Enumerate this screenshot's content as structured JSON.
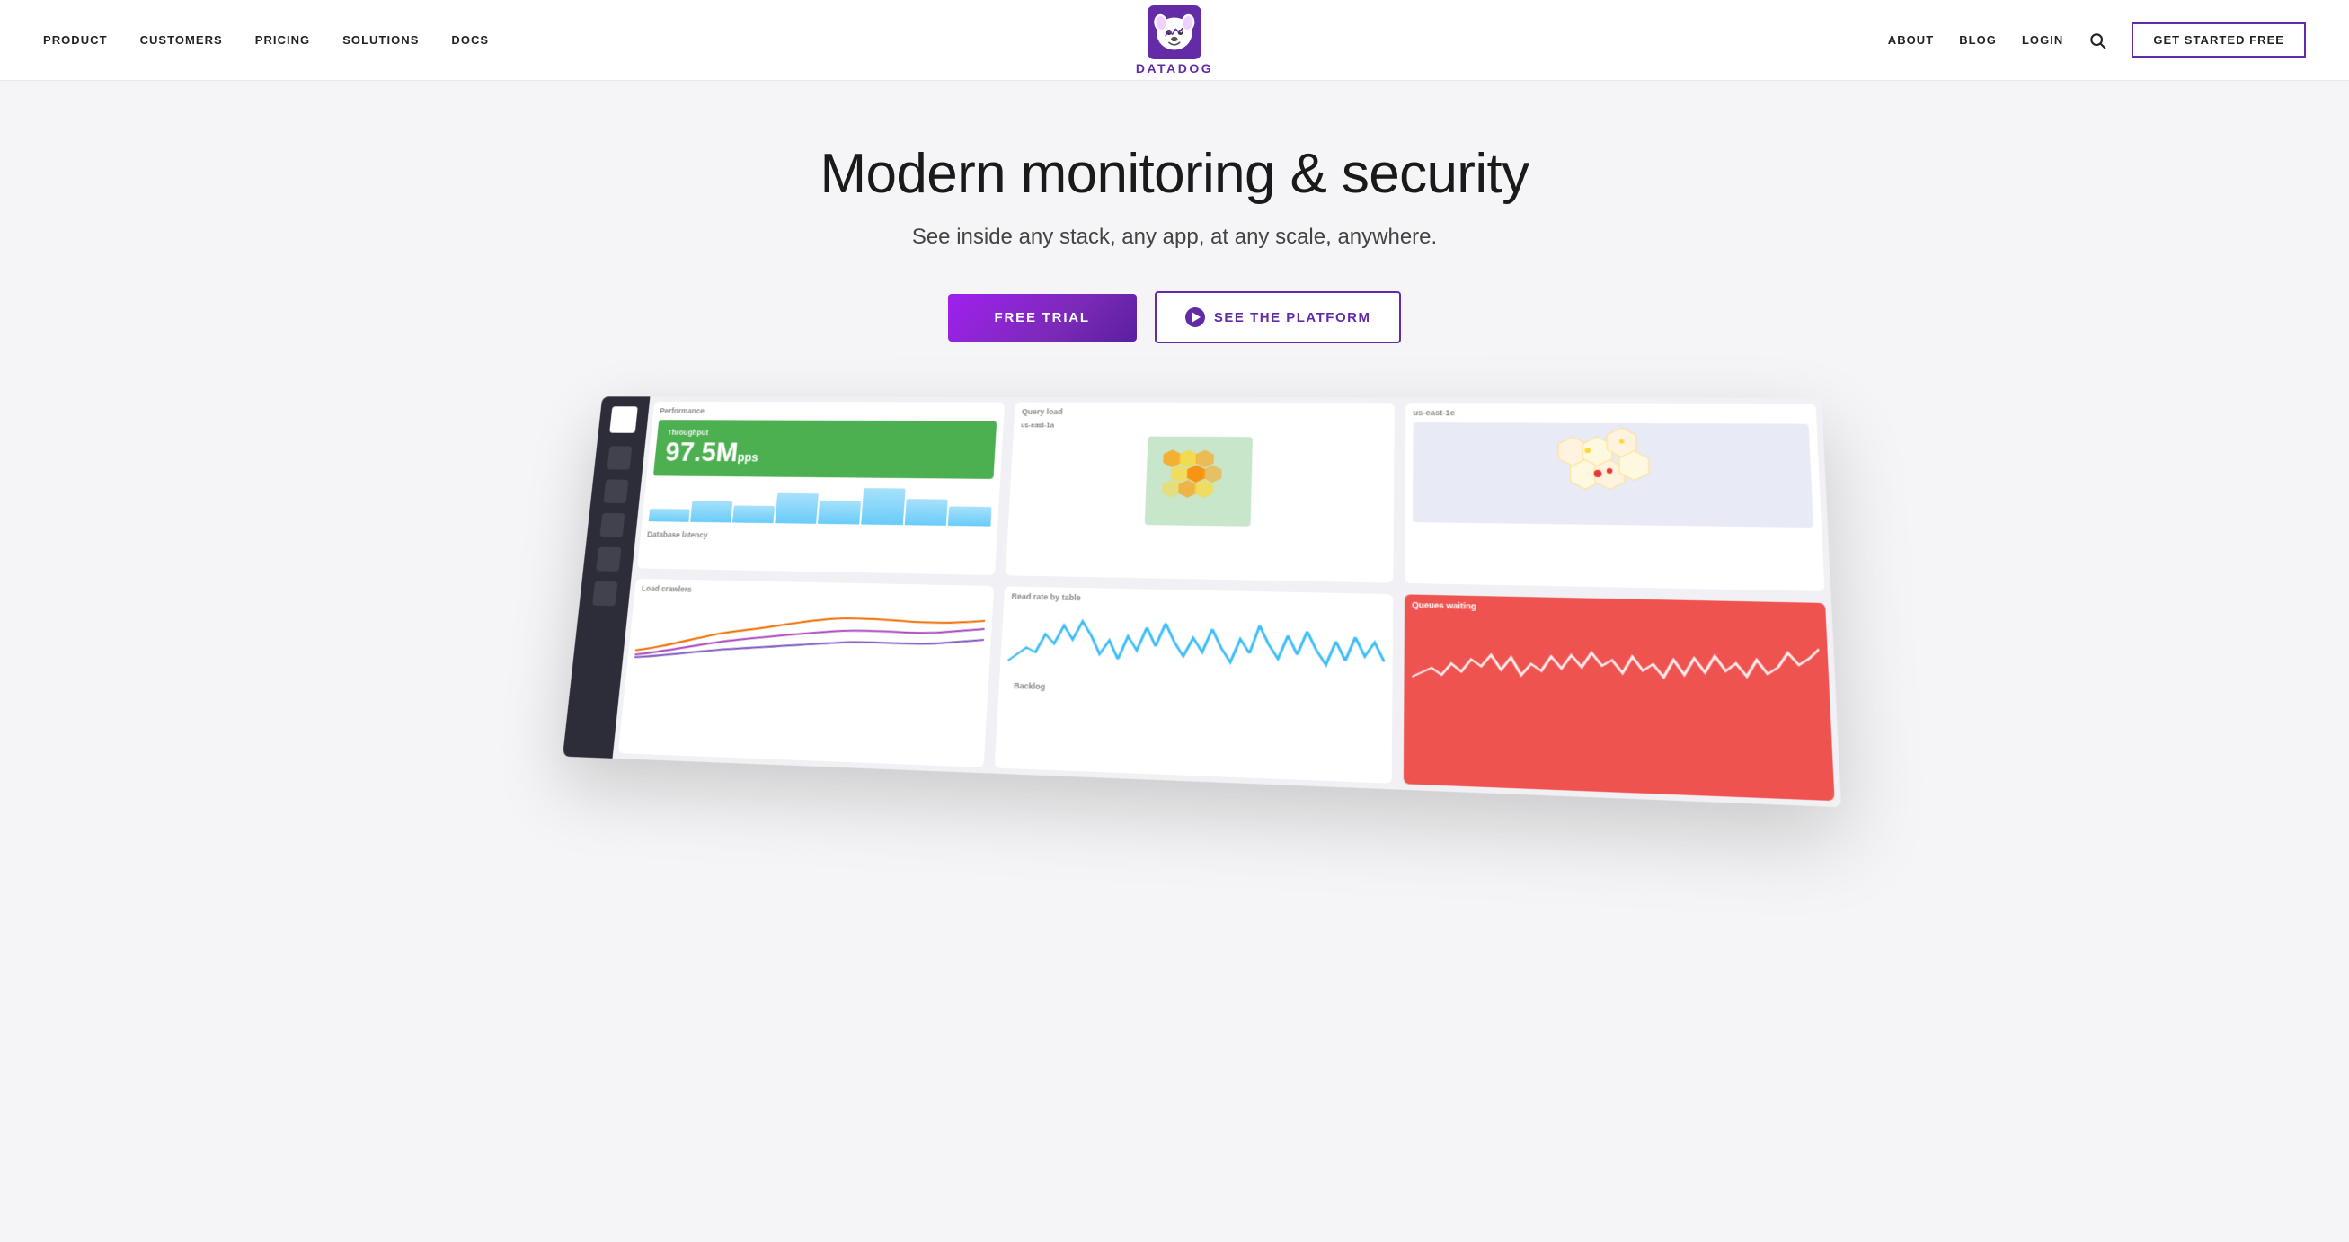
{
  "nav": {
    "left": [
      {
        "label": "PRODUCT",
        "id": "product"
      },
      {
        "label": "CUSTOMERS",
        "id": "customers"
      },
      {
        "label": "PRICING",
        "id": "pricing"
      },
      {
        "label": "SOLUTIONS",
        "id": "solutions"
      },
      {
        "label": "DOCS",
        "id": "docs"
      }
    ],
    "right": [
      {
        "label": "ABOUT",
        "id": "about"
      },
      {
        "label": "BLOG",
        "id": "blog"
      },
      {
        "label": "LOGIN",
        "id": "login"
      }
    ],
    "cta": "GET STARTED FREE"
  },
  "brand": {
    "name": "DATADOG"
  },
  "hero": {
    "headline": "Modern monitoring & security",
    "subheadline": "See inside any stack, any app, at any scale, anywhere.",
    "cta_primary": "FREE TRIAL",
    "cta_secondary": "SEE THE PLATFORM"
  },
  "dashboard": {
    "throughput_label": "Throughput",
    "throughput_value": "97.5M",
    "throughput_unit": "pps",
    "performance_label": "Performance",
    "query_load_label": "Query load",
    "us_east_label": "us-east-1a",
    "us_east2_label": "us-east-1e",
    "db_latency_label": "Database latency",
    "load_crawlers_label": "Load crawlers",
    "read_rate_label": "Read rate by table",
    "backlog_label": "Backlog",
    "queues_label": "Queues waiting"
  }
}
